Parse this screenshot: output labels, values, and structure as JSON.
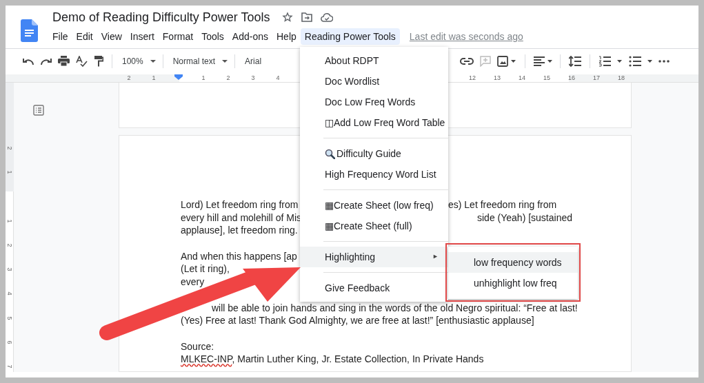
{
  "window": {
    "title": "Demo of Reading Difficulty Power Tools"
  },
  "menubar": [
    {
      "label": "File",
      "selected": false
    },
    {
      "label": "Edit",
      "selected": false
    },
    {
      "label": "View",
      "selected": false
    },
    {
      "label": "Insert",
      "selected": false
    },
    {
      "label": "Format",
      "selected": false
    },
    {
      "label": "Tools",
      "selected": false
    },
    {
      "label": "Add-ons",
      "selected": false
    },
    {
      "label": "Help",
      "selected": false
    },
    {
      "label": "Reading Power Tools",
      "selected": true
    }
  ],
  "last_edit": "Last edit was seconds ago",
  "toolbar": {
    "zoom": "100%",
    "style": "Normal text",
    "font": "Arial"
  },
  "ruler": {
    "left_labels": [
      "2",
      "1",
      "1",
      "2",
      "3",
      "4"
    ],
    "right_labels": [
      "12",
      "13",
      "14",
      "15",
      "16",
      "17",
      "18"
    ]
  },
  "vertical_ruler": {
    "labels": [
      "2",
      "1",
      "1",
      "2",
      "3",
      "4",
      "5",
      "6",
      "7"
    ]
  },
  "document": {
    "paragraphs": [
      {
        "lines": [
          {
            "fragments": [
              {
                "text": "Lord) Let freedom ring from"
              },
              {
                "text": "es) Let freedom ring from"
              }
            ]
          },
          {
            "fragments": [
              {
                "text": "every hill and molehill of Mis"
              },
              {
                "text": "side (Yeah) [sustained"
              }
            ]
          },
          {
            "fragments": [
              {
                "text": "applause], let freedom ring."
              }
            ]
          }
        ]
      },
      {
        "lines": [
          {
            "fragments": [
              {
                "text": "And when this happens [ap"
              }
            ]
          },
          {
            "fragments": [
              {
                "text": "(Let it ring),"
              }
            ]
          },
          {
            "fragments": [
              {
                "text": "every"
              }
            ]
          },
          {
            "fragments": [
              {
                "text": "will be able to join hands and sing in the words of the old Negro spiritual: “Free at last!"
              }
            ]
          },
          {
            "fragments": [
              {
                "text": "(Yes) Free at last! Thank God Almighty, we are free at last!” [enthusiastic applause]"
              }
            ]
          }
        ]
      },
      {
        "lines": [
          {
            "fragments": [
              {
                "text": "Source:"
              }
            ]
          },
          {
            "fragments": [
              {
                "parts": [
                  {
                    "text": "MLKEC-INP",
                    "misspelled": true
                  },
                  {
                    "text": ", Martin Luther King, Jr. Estate Collection, In Private Hands",
                    "misspelled": false
                  }
                ]
              }
            ]
          }
        ]
      }
    ]
  },
  "menu": {
    "items": [
      {
        "kind": "item",
        "label": "About RDPT"
      },
      {
        "kind": "item",
        "label": "Doc Wordlist"
      },
      {
        "kind": "item",
        "label": "Doc Low Freq Words"
      },
      {
        "kind": "item",
        "label": "◫Add Low Freq Word Table"
      },
      {
        "kind": "separator"
      },
      {
        "kind": "search",
        "label": "Difficulty Guide"
      },
      {
        "kind": "item",
        "label": "High Frequency Word List"
      },
      {
        "kind": "separator"
      },
      {
        "kind": "item",
        "label": "▦Create Sheet (low freq)"
      },
      {
        "kind": "item",
        "label": "▦Create Sheet (full)"
      },
      {
        "kind": "separator"
      },
      {
        "kind": "submenu",
        "label": "Highlighting",
        "arrow": "►",
        "selected": true
      },
      {
        "kind": "separator"
      },
      {
        "kind": "item",
        "label": "Give Feedback"
      }
    ]
  },
  "submenu": {
    "items": [
      {
        "label": "low frequency words",
        "selected": true
      },
      {
        "label": "unhighlight low freq",
        "selected": false
      }
    ]
  }
}
